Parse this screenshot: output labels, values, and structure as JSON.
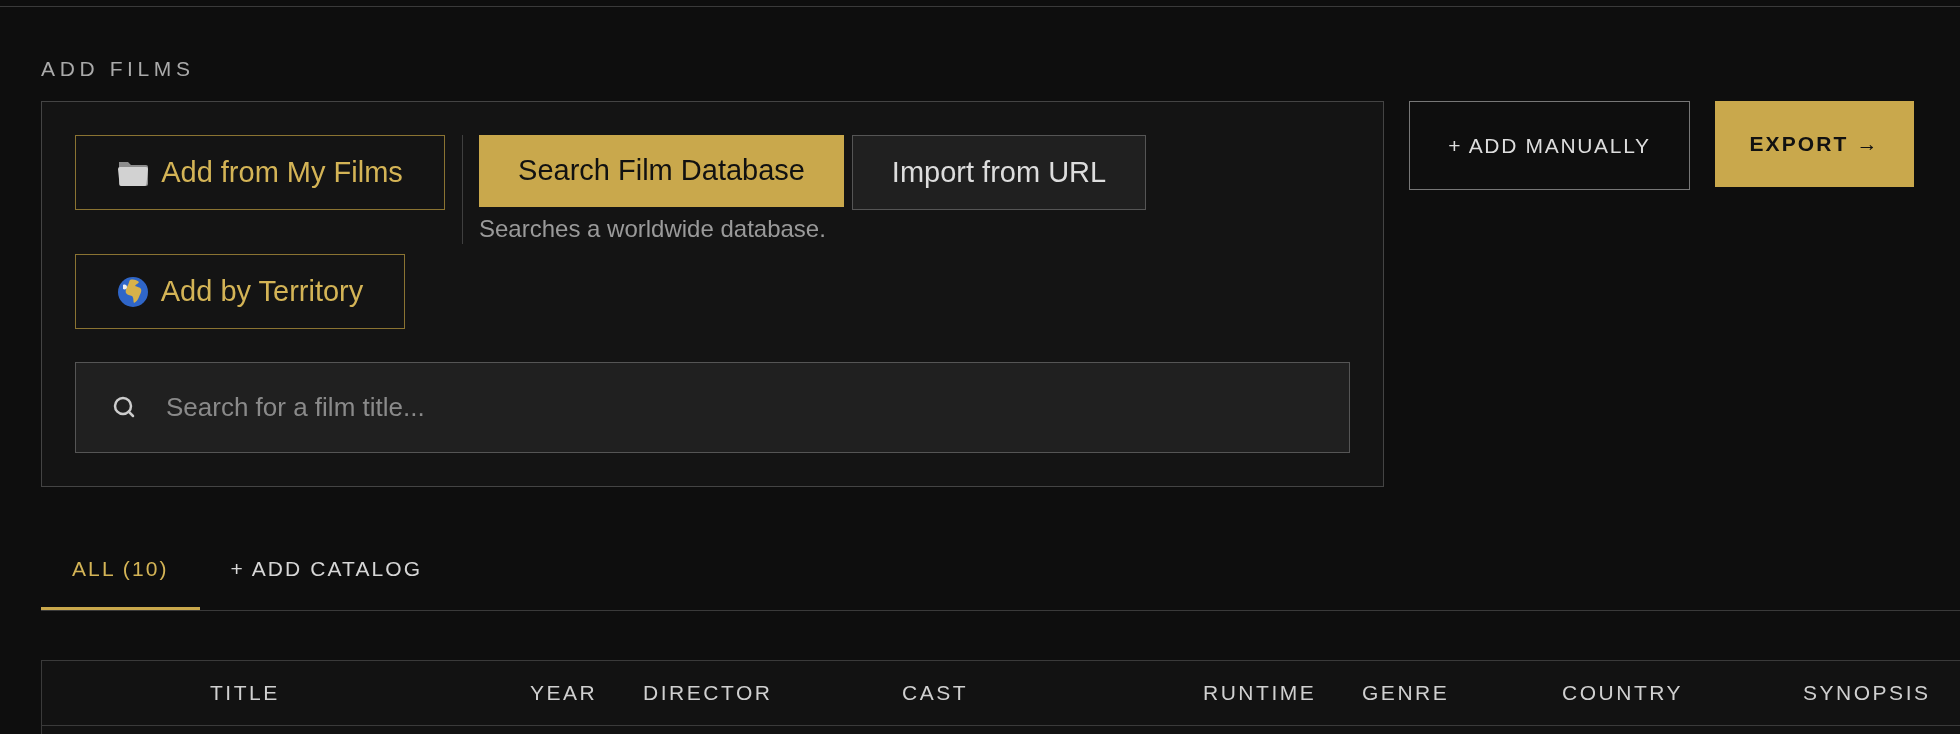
{
  "section_title": "ADD FILMS",
  "add_panel": {
    "my_films_button": {
      "label": "Add from My Films"
    },
    "modes": [
      {
        "label": "Search Film Database",
        "selected": true
      },
      {
        "label": "Import from URL",
        "selected": false
      }
    ],
    "mode_hint": "Searches a worldwide database.",
    "territory_button": {
      "label": "Add by Territory"
    },
    "search": {
      "placeholder": "Search for a film title..."
    }
  },
  "actions": [
    {
      "label": "+ ADD MANUALLY",
      "kind": "outline"
    },
    {
      "label": "EXPORT →",
      "kind": "primary"
    }
  ],
  "tabs": [
    {
      "label": "ALL (10)",
      "selected": true
    },
    {
      "label": "+ ADD CATALOG",
      "selected": false
    }
  ],
  "table": {
    "columns": [
      "TITLE",
      "YEAR",
      "DIRECTOR",
      "CAST",
      "RUNTIME",
      "GENRE",
      "COUNTRY",
      "SYNOPSIS"
    ]
  }
}
